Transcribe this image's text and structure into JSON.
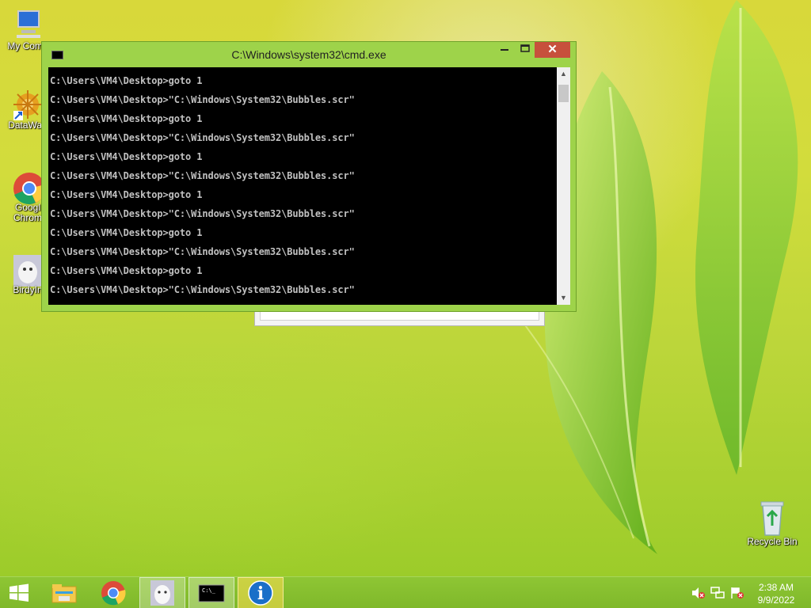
{
  "desktop": {
    "icons": [
      {
        "label": "My Comp",
        "icon": "computer-icon"
      },
      {
        "label": "DataWag",
        "icon": "datawag-icon"
      },
      {
        "label": "Googl Chrom",
        "icon": "chrome-icon"
      },
      {
        "label": "BirdyIn",
        "icon": "birdy-icon"
      },
      {
        "label": "Recycle Bin",
        "icon": "recycle-bin-icon"
      }
    ]
  },
  "cmd": {
    "title": "C:\\Windows\\system32\\cmd.exe",
    "min_label": "▭",
    "max_label": "□",
    "close_label": "✕",
    "lines": [
      "C:\\Users\\VM4\\Desktop>goto 1",
      "C:\\Users\\VM4\\Desktop>\"C:\\Windows\\System32\\Bubbles.scr\"",
      "C:\\Users\\VM4\\Desktop>goto 1",
      "C:\\Users\\VM4\\Desktop>\"C:\\Windows\\System32\\Bubbles.scr\"",
      "C:\\Users\\VM4\\Desktop>goto 1",
      "C:\\Users\\VM4\\Desktop>\"C:\\Windows\\System32\\Bubbles.scr\"",
      "C:\\Users\\VM4\\Desktop>goto 1",
      "C:\\Users\\VM4\\Desktop>\"C:\\Windows\\System32\\Bubbles.scr\"",
      "C:\\Users\\VM4\\Desktop>goto 1",
      "C:\\Users\\VM4\\Desktop>\"C:\\Windows\\System32\\Bubbles.scr\"",
      "C:\\Users\\VM4\\Desktop>goto 1",
      "C:\\Users\\VM4\\Desktop>\"C:\\Windows\\System32\\Bubbles.scr\""
    ]
  },
  "taskbar": {
    "items": [
      {
        "icon": "windows-start-icon"
      },
      {
        "icon": "file-explorer-icon"
      },
      {
        "icon": "chrome-icon"
      },
      {
        "icon": "birdy-icon"
      },
      {
        "icon": "cmd-icon",
        "active": true
      },
      {
        "icon": "info-icon"
      }
    ],
    "cmd_icon_text": "C:\\_",
    "info_icon_text": "i",
    "clock_time": "2:38 AM",
    "clock_date": "9/9/2022"
  },
  "colors": {
    "accent": "#9ed34a",
    "close_button": "#c7503c",
    "console_bg": "#000000",
    "console_text": "#c0c0c0"
  }
}
